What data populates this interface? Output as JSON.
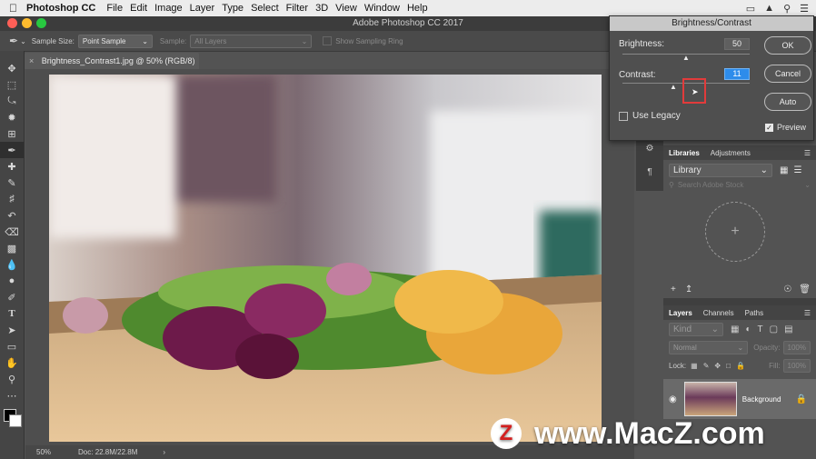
{
  "menubar": {
    "apple": "",
    "app": "Photoshop CC",
    "items": [
      "File",
      "Edit",
      "Image",
      "Layer",
      "Type",
      "Select",
      "Filter",
      "3D",
      "View",
      "Window",
      "Help"
    ]
  },
  "window": {
    "title": "Adobe Photoshop CC 2017"
  },
  "options": {
    "sample_size_label": "Sample Size:",
    "sample_size_value": "Point Sample",
    "sample_label": "Sample:",
    "sample_value": "All Layers",
    "show_ring": "Show Sampling Ring"
  },
  "document": {
    "tab": "Brightness_Contrast1.jpg @ 50% (RGB/8)"
  },
  "status": {
    "zoom": "50%",
    "doc": "Doc: 22.8M/22.8M"
  },
  "dialog": {
    "title": "Brightness/Contrast",
    "brightness_label": "Brightness:",
    "brightness_value": "50",
    "brightness_fraction": 0.5,
    "contrast_label": "Contrast:",
    "contrast_value": "11",
    "contrast_fraction": 0.4,
    "legacy_label": "Use Legacy",
    "legacy_checked": false,
    "ok": "OK",
    "cancel": "Cancel",
    "auto": "Auto",
    "preview_label": "Preview",
    "preview_checked": true
  },
  "libraries": {
    "tabs": [
      "Libraries",
      "Adjustments"
    ],
    "library_select": "Library",
    "search_placeholder": "Search Adobe Stock"
  },
  "layers": {
    "tabs": [
      "Layers",
      "Channels",
      "Paths"
    ],
    "kind": "Kind",
    "blend": "Normal",
    "opacity_label": "Opacity:",
    "opacity_value": "100%",
    "lock_label": "Lock:",
    "fill_label": "Fill:",
    "fill_value": "100%",
    "layer_name": "Background"
  },
  "watermark": {
    "z": "Z",
    "text": "www.MacZ.com"
  },
  "colors": {
    "accent": "#2d8ceb",
    "highlight_box": "#e23b3b"
  }
}
